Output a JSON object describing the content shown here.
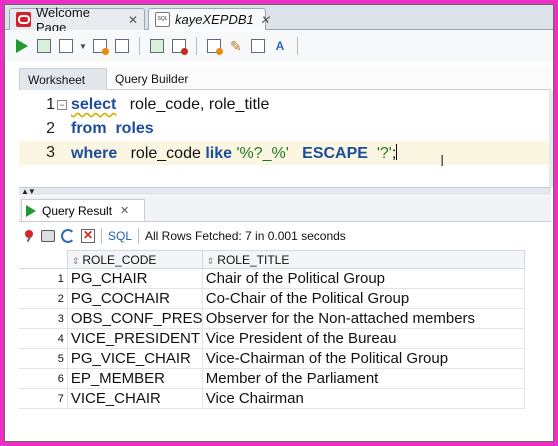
{
  "tabs": [
    {
      "label": "Welcome Page",
      "icon": "oracle-icon"
    },
    {
      "label": "kayeXEPDB1",
      "icon": "sql-db-icon"
    }
  ],
  "subtabs": {
    "worksheet": "Worksheet",
    "query_builder": "Query Builder"
  },
  "editor": {
    "line_numbers": [
      "1",
      "2",
      "3"
    ],
    "line1": {
      "kw": "select",
      "rest": "   role_code, role_title"
    },
    "line2": {
      "kw": "from",
      "rest": "  roles"
    },
    "line3": {
      "kw": "where",
      "a": "   role_code ",
      "kw2": "like",
      "str": " '%?_%'",
      "b": "   ",
      "kw3": "ESCAPE",
      "str2": "  '?'",
      "end": ";"
    }
  },
  "results": {
    "tab_label": "Query Result",
    "sql_label": "SQL",
    "fetch_status": "All Rows Fetched: 7 in 0.001 seconds",
    "columns": [
      "ROLE_CODE",
      "ROLE_TITLE"
    ],
    "rows": [
      {
        "n": "1",
        "code": "PG_CHAIR",
        "title": "Chair of the Political Group"
      },
      {
        "n": "2",
        "code": "PG_COCHAIR",
        "title": "Co-Chair of the Political Group"
      },
      {
        "n": "3",
        "code": "OBS_CONF_PRES",
        "title": "Observer for the Non-attached members"
      },
      {
        "n": "4",
        "code": "VICE_PRESIDENT",
        "title": "Vice President of the Bureau"
      },
      {
        "n": "5",
        "code": "PG_VICE_CHAIR",
        "title": "Vice-Chairman of the Political Group"
      },
      {
        "n": "6",
        "code": "EP_MEMBER",
        "title": "Member of the Parliament"
      },
      {
        "n": "7",
        "code": "VICE_CHAIR",
        "title": "Vice Chairman"
      }
    ]
  },
  "colors": {
    "border": "#ee2fc4",
    "keyword": "#1c4d9b",
    "string": "#1f7a1f",
    "run_green": "#1e9a2e"
  }
}
